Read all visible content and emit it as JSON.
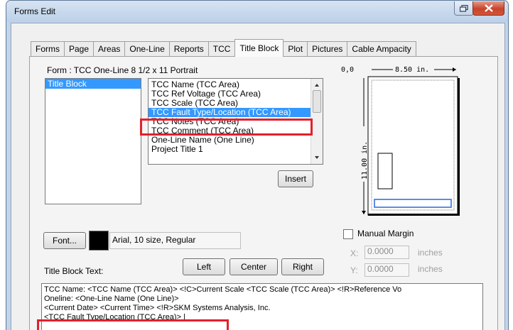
{
  "window": {
    "title": "Forms Edit"
  },
  "tabs": [
    "Forms",
    "Page",
    "Areas",
    "One-Line",
    "Reports",
    "TCC",
    "Title Block",
    "Plot",
    "Pictures",
    "Cable Ampacity"
  ],
  "form_label": "Form : TCC  One-Line 8 1/2 x 11 Portrait",
  "left_list": [
    "Title Block"
  ],
  "field_list": [
    "TCC Name (TCC Area)",
    "TCC Ref Voltage (TCC Area)",
    "TCC Scale (TCC Area)",
    "TCC Fault Type/Location (TCC Area)",
    "TCC Notes (TCC Area)",
    "TCC Comment (TCC Area)",
    "One-Line Name (One Line)",
    "Project Title 1"
  ],
  "insert_label": "Insert",
  "preview": {
    "origin": "0,0",
    "width": "8.50 in.",
    "height": "11.00 in."
  },
  "font": {
    "button": "Font...",
    "color": "#000000",
    "description": "Arial, 10 size, Regular"
  },
  "title_block_text_label": "Title Block Text:",
  "align_buttons": [
    "Left",
    "Center",
    "Right"
  ],
  "manual_margin": {
    "label": "Manual Margin",
    "checked": false,
    "x_label": "X:",
    "x_value": "0.0000",
    "y_label": "Y:",
    "y_value": "0.0000",
    "unit": "inches"
  },
  "text_lines": [
    "TCC Name:  <TCC Name (TCC Area)> <!C>Current Scale <TCC Scale (TCC Area)> <!R>Reference Vo",
    "Oneline:      <One-Line Name (One Line)>",
    "<Current Date> <Current Time> <!R>SKM Systems Analysis, Inc.",
    "<TCC Fault Type/Location (TCC Area)> |"
  ]
}
